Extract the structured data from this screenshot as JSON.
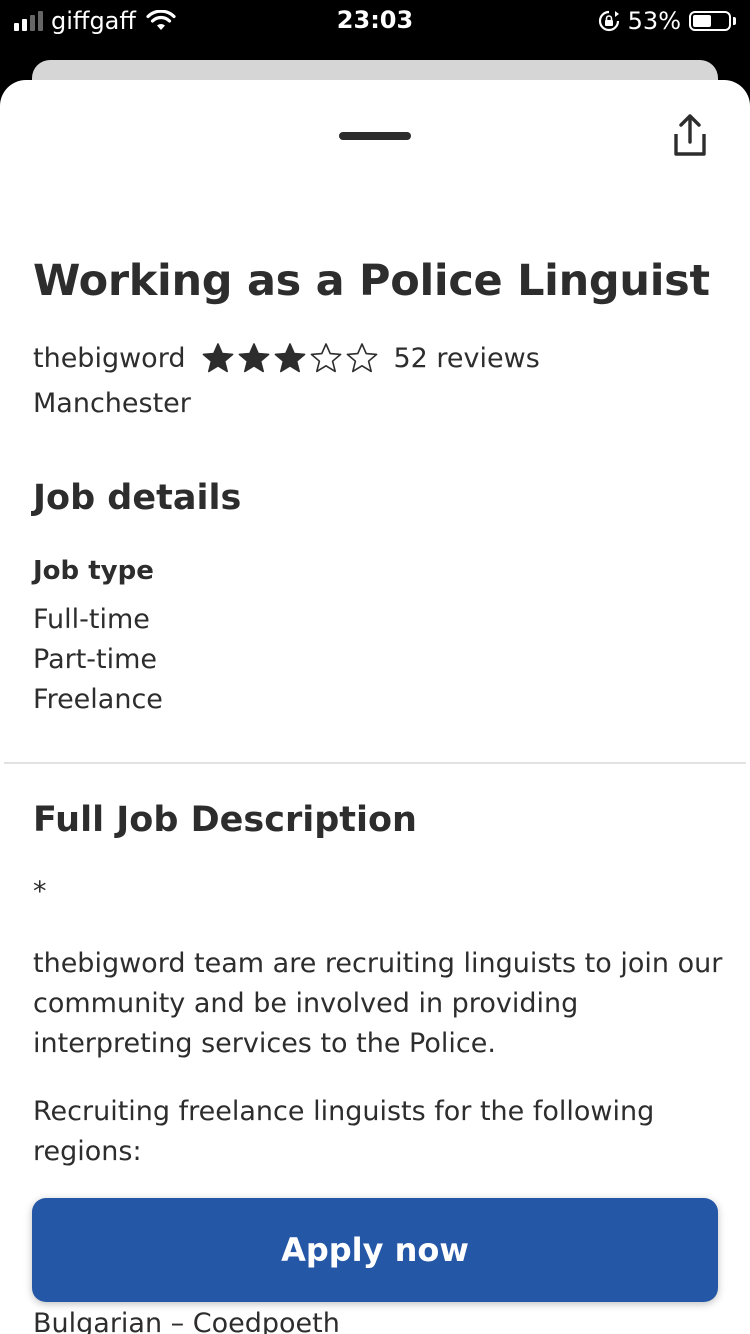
{
  "status_bar": {
    "carrier": "giffgaff",
    "time": "23:03",
    "battery_percent": "53%",
    "battery_level": 0.53,
    "signal_bars": 4,
    "signal_bars_active": 2
  },
  "job": {
    "title": "Working as a Police Linguist",
    "company": "thebigword",
    "rating": 3,
    "rating_max": 5,
    "reviews": "52 reviews",
    "location": "Manchester"
  },
  "job_details": {
    "heading": "Job details",
    "job_type_label": "Job type",
    "job_types": [
      "Full-time",
      "Part-time",
      "Freelance"
    ]
  },
  "description": {
    "heading": "Full Job Description",
    "bullet": "*",
    "paragraph1": "thebigword team are recruiting linguists to join our community and be involved in providing interpreting services to the Police.",
    "paragraph2": "Recruiting freelance linguists for the following regions:",
    "partial_line": "Bulgarian – Coedpoeth"
  },
  "actions": {
    "apply_label": "Apply now"
  },
  "colors": {
    "accent": "#2557a7",
    "text": "#2d2d2d",
    "divider": "#e4e2e0"
  },
  "icons": {
    "share": "share-icon",
    "star_filled": "star-filled-icon",
    "star_empty": "star-outline-icon"
  }
}
